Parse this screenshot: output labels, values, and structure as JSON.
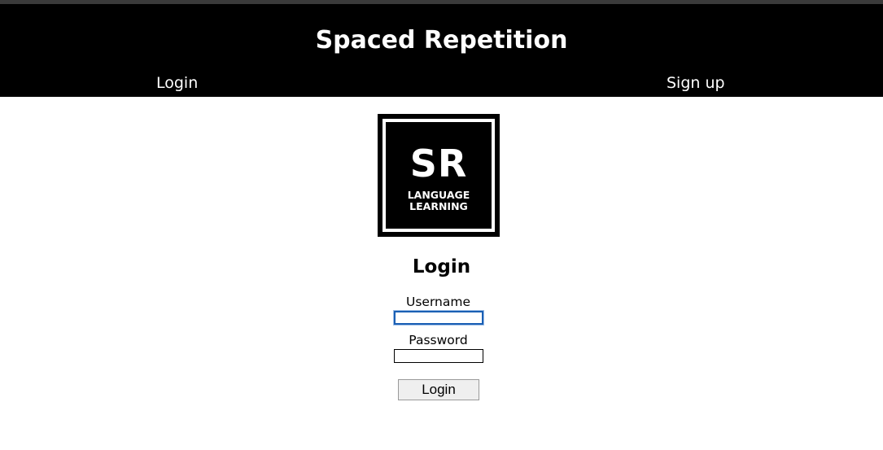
{
  "header": {
    "title": "Spaced Repetition",
    "nav": {
      "login_label": "Login",
      "signup_label": "Sign up"
    }
  },
  "logo": {
    "initials": "SR",
    "line1": "LANGUAGE",
    "line2": "LEARNING"
  },
  "form": {
    "title": "Login",
    "username_label": "Username",
    "username_value": "",
    "password_label": "Password",
    "password_value": "",
    "submit_label": "Login"
  },
  "colors": {
    "header_background": "#000000",
    "header_text": "#ffffff",
    "focus_ring": "#1a5fb4"
  }
}
